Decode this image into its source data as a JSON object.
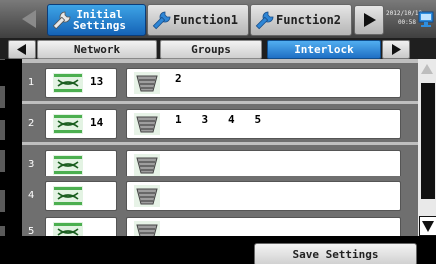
{
  "header": {
    "tabs": [
      {
        "label": "Initial\nSettings",
        "icon": "wrench-icon",
        "active": true
      },
      {
        "label": "Function1",
        "icon": "wrench-icon",
        "active": false
      },
      {
        "label": "Function2",
        "icon": "wrench-icon",
        "active": false
      }
    ],
    "datetime": {
      "date": "2012/10/19",
      "time": "00:58"
    }
  },
  "subtabs": [
    {
      "label": "Network",
      "active": false
    },
    {
      "label": "Groups",
      "active": false
    },
    {
      "label": "Interlock",
      "active": true
    }
  ],
  "rows": [
    {
      "index": "1",
      "unit_number": "13",
      "interlock_units": "2"
    },
    {
      "index": "2",
      "unit_number": "14",
      "interlock_units": "1 3 4 5"
    },
    {
      "index": "3",
      "unit_number": "",
      "interlock_units": ""
    },
    {
      "index": "4",
      "unit_number": "",
      "interlock_units": ""
    },
    {
      "index": "5",
      "unit_number": "",
      "interlock_units": ""
    }
  ],
  "footer": {
    "save_label": "Save Settings"
  },
  "colors": {
    "accent_blue": "#1e6fc4",
    "row_strip": "#6f6f6f",
    "content_bg": "#bfbfbf"
  }
}
